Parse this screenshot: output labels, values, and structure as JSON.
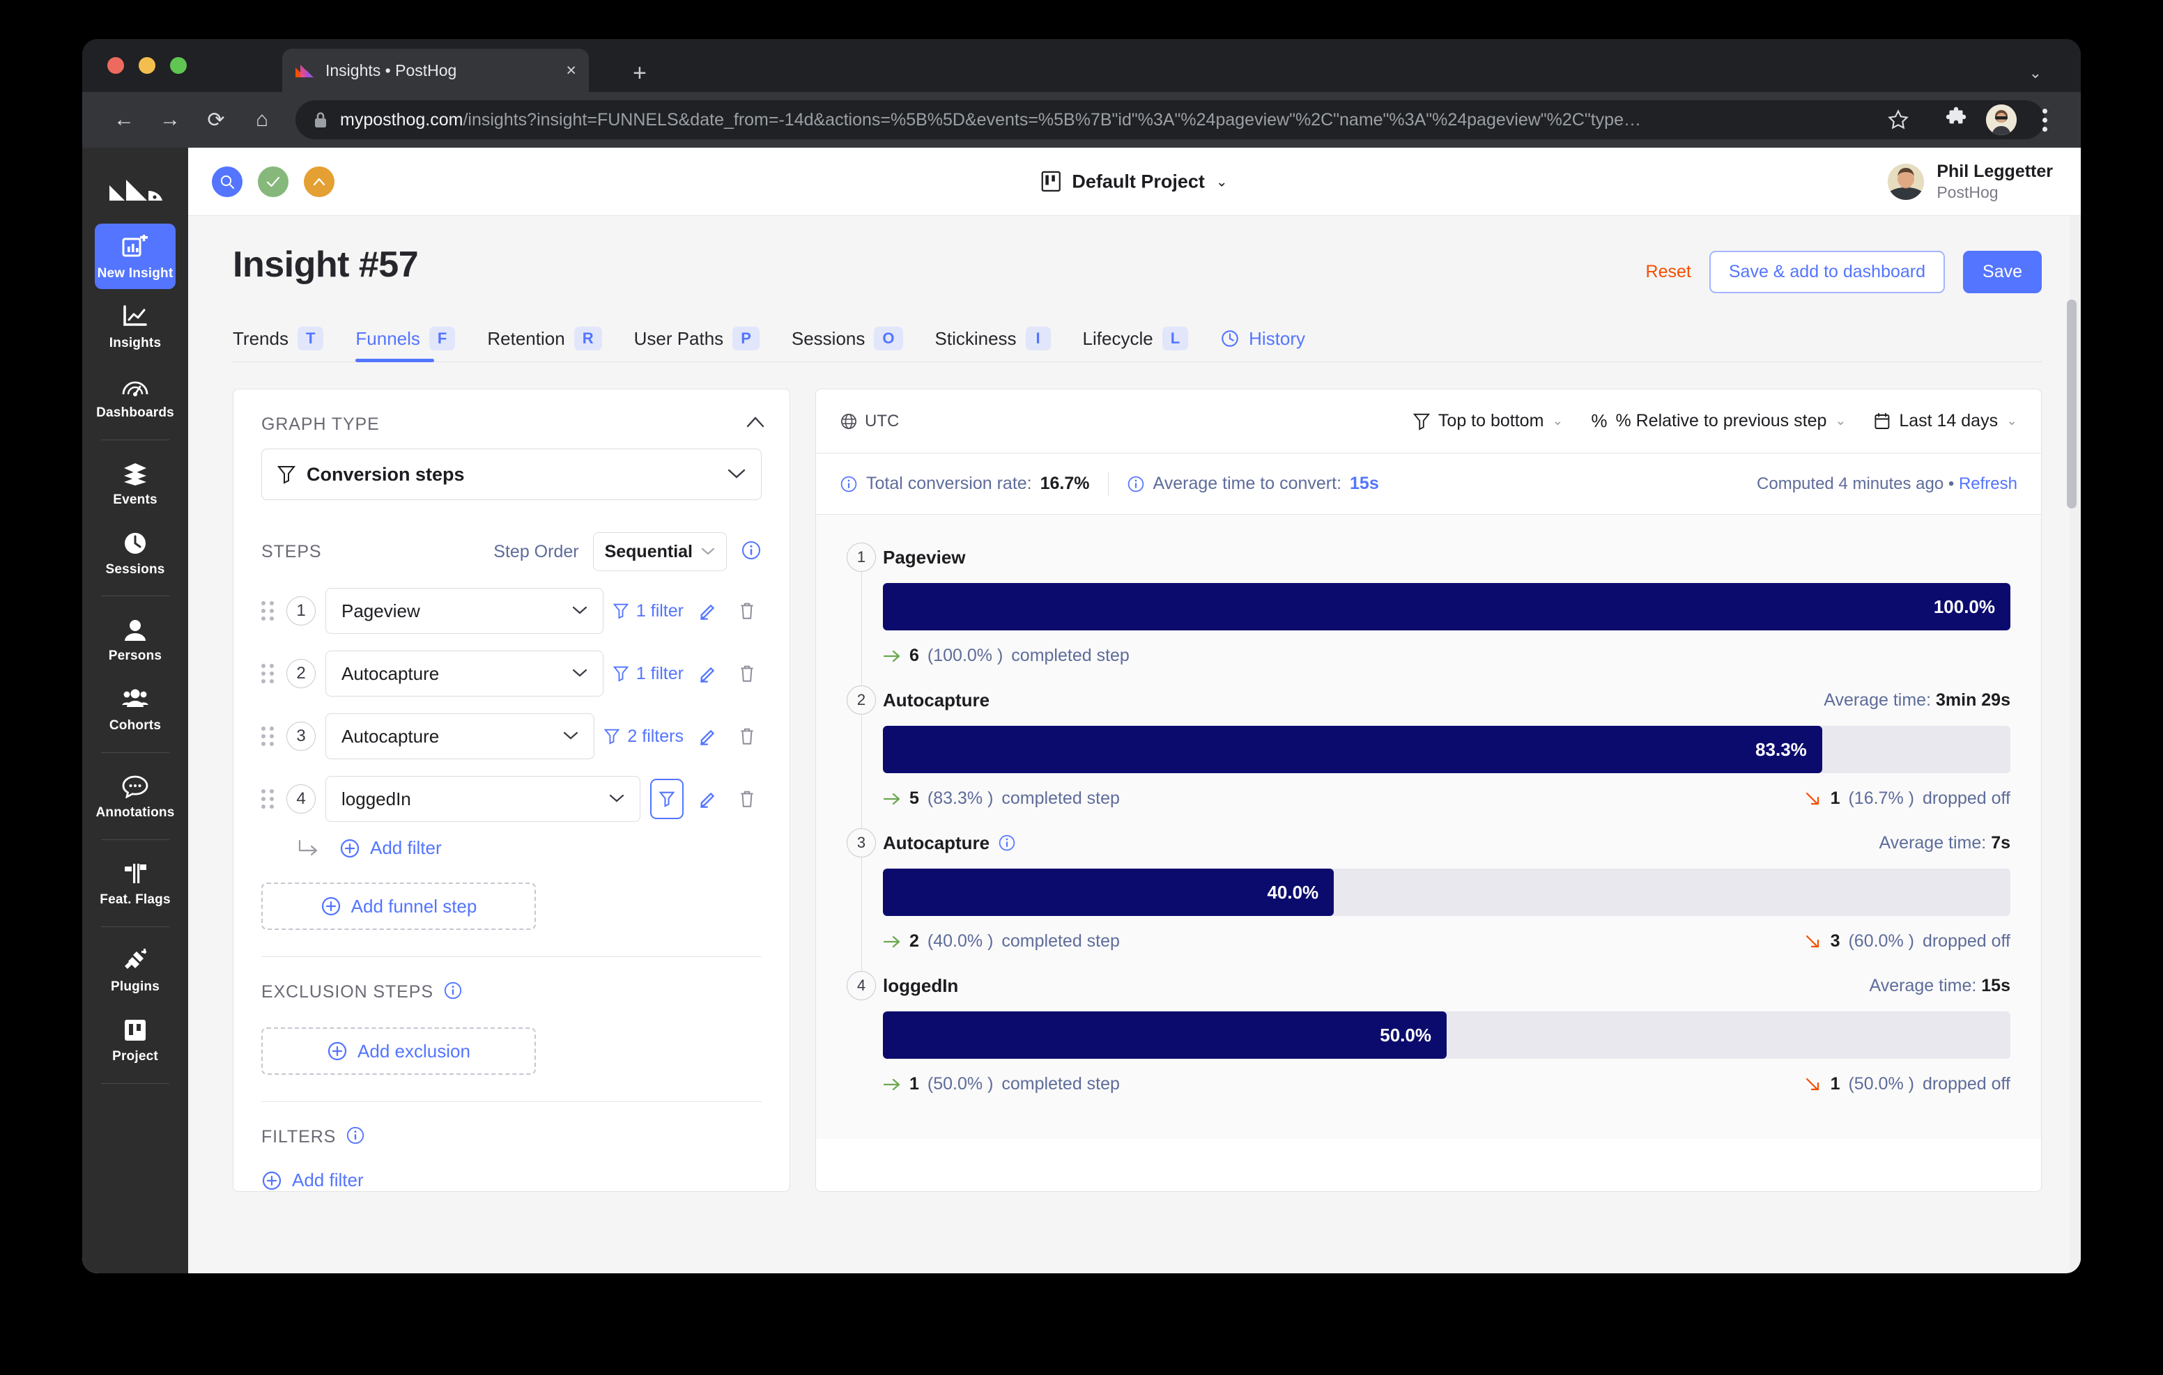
{
  "browser": {
    "tab": {
      "title": "Insights • PostHog",
      "favicon": "posthog-logo-icon",
      "close": "×"
    },
    "new_tab": "+",
    "tabstrip_chevron": "⌄",
    "nav": {
      "back": "←",
      "forward": "→",
      "reload": "⟳",
      "home": "⌂"
    },
    "url": {
      "host": "myposthog.com",
      "path": "/insights?insight=FUNNELS&date_from=-14d&actions=%5B%5D&events=%5B%7B\"id\"%3A\"%24pageview\"%2C\"name\"%3A\"%24pageview\"%2C\"type…"
    }
  },
  "sidebar": {
    "logo": "posthog-logo",
    "items": [
      {
        "label": "New Insight",
        "icon": "new-insight-icon",
        "active": true,
        "divider_after": false
      },
      {
        "label": "Insights",
        "icon": "insights-icon",
        "active": false,
        "divider_after": false
      },
      {
        "label": "Dashboards",
        "icon": "dashboards-icon",
        "active": false,
        "divider_after": true
      },
      {
        "label": "Events",
        "icon": "events-icon",
        "active": false,
        "divider_after": false
      },
      {
        "label": "Sessions",
        "icon": "sessions-icon",
        "active": false,
        "divider_after": true
      },
      {
        "label": "Persons",
        "icon": "persons-icon",
        "active": false,
        "divider_after": false
      },
      {
        "label": "Cohorts",
        "icon": "cohorts-icon",
        "active": false,
        "divider_after": true
      },
      {
        "label": "Annotations",
        "icon": "annotations-icon",
        "active": false,
        "divider_after": true
      },
      {
        "label": "Feat. Flags",
        "icon": "feature-flags-icon",
        "active": false,
        "divider_after": true
      },
      {
        "label": "Plugins",
        "icon": "plugins-icon",
        "active": false,
        "divider_after": false
      },
      {
        "label": "Project",
        "icon": "project-icon",
        "active": false,
        "divider_after": true
      }
    ]
  },
  "appbar": {
    "search_icon": "search-icon",
    "check_icon": "check-icon",
    "caret_up_icon": "caret-up-icon",
    "project_icon": "project-board-icon",
    "project_name": "Default Project",
    "project_caret": "⌄",
    "user_name": "Phil Leggetter",
    "user_org": "PostHog"
  },
  "page": {
    "title": "Insight #57",
    "reset_label": "Reset",
    "save_dashboard_label": "Save & add to dashboard",
    "save_label": "Save"
  },
  "insight_tabs": [
    {
      "label": "Trends",
      "key": "T",
      "active": false
    },
    {
      "label": "Funnels",
      "key": "F",
      "active": true
    },
    {
      "label": "Retention",
      "key": "R",
      "active": false
    },
    {
      "label": "User Paths",
      "key": "P",
      "active": false
    },
    {
      "label": "Sessions",
      "key": "O",
      "active": false
    },
    {
      "label": "Stickiness",
      "key": "I",
      "active": false
    },
    {
      "label": "Lifecycle",
      "key": "L",
      "active": false
    }
  ],
  "history_tab": {
    "label": "History",
    "icon": "clock-icon"
  },
  "left_panel": {
    "graph_type_label": "GRAPH TYPE",
    "graph_type_value": "Conversion steps",
    "graph_type_icon": "funnel-icon",
    "collapse_icon": "chevron-up-icon",
    "steps_label": "STEPS",
    "step_order_label": "Step Order",
    "step_order_value": "Sequential",
    "step_order_info_icon": "info-icon",
    "steps": [
      {
        "num": "1",
        "event": "Pageview",
        "filter_label": "1 filter",
        "has_filter_text": true,
        "filter_active": false
      },
      {
        "num": "2",
        "event": "Autocapture",
        "filter_label": "1 filter",
        "has_filter_text": true,
        "filter_active": false
      },
      {
        "num": "3",
        "event": "Autocapture",
        "filter_label": "2 filters",
        "has_filter_text": true,
        "filter_active": false
      },
      {
        "num": "4",
        "event": "loggedIn",
        "filter_label": "",
        "has_filter_text": false,
        "filter_active": true
      }
    ],
    "add_filter_label": "Add filter",
    "add_funnel_step_label": "Add funnel step",
    "exclusion_steps_label": "EXCLUSION STEPS",
    "add_exclusion_label": "Add exclusion",
    "filters_label": "FILTERS",
    "filters_add_label": "Add filter"
  },
  "right_panel": {
    "timezone": "UTC",
    "timezone_icon": "globe-icon",
    "controls": [
      {
        "label": "Top to bottom",
        "icon": "funnel-icon",
        "caret": "⌄"
      },
      {
        "label": "% Relative to previous step",
        "icon": "percent-icon",
        "caret": "⌄"
      },
      {
        "label": "Last 14 days",
        "icon": "calendar-icon",
        "caret": "⌄"
      }
    ],
    "stats": {
      "total_conversion_label": "Total conversion rate:",
      "total_conversion_value": "16.7%",
      "avg_time_label": "Average time to convert:",
      "avg_time_value": "15s",
      "computed_text": "Computed 4 minutes ago",
      "computed_sep": "•",
      "refresh_label": "Refresh",
      "info_icon": "info-icon"
    }
  },
  "chart_data": {
    "type": "bar",
    "title": "Conversion steps funnel",
    "orientation": "horizontal",
    "bar_color": "#0B0B6E",
    "track_color": "#E8E8EE",
    "categories": [
      "Pageview",
      "Autocapture",
      "Autocapture",
      "loggedIn"
    ],
    "values": [
      100.0,
      83.3,
      40.0,
      50.0
    ],
    "value_labels": [
      "100.0%",
      "83.3%",
      "40.0%",
      "50.0%"
    ],
    "ylim": [
      0,
      100
    ],
    "metric": "% Relative to previous step",
    "steps": [
      {
        "index": "1",
        "name": "Pageview",
        "percent": 100.0,
        "percent_label": "100.0%",
        "avg_time": "",
        "has_avg_time": false,
        "has_info": false,
        "completed_count": "6",
        "completed_pct": "(100.0% )",
        "completed_suffix": "completed step",
        "has_dropoff": false,
        "dropoff_count": "",
        "dropoff_pct": "",
        "dropoff_suffix": ""
      },
      {
        "index": "2",
        "name": "Autocapture",
        "percent": 83.3,
        "percent_label": "83.3%",
        "avg_time": "3min 29s",
        "has_avg_time": true,
        "has_info": false,
        "completed_count": "5",
        "completed_pct": "(83.3% )",
        "completed_suffix": "completed step",
        "has_dropoff": true,
        "dropoff_count": "1",
        "dropoff_pct": "(16.7% )",
        "dropoff_suffix": "dropped off"
      },
      {
        "index": "3",
        "name": "Autocapture",
        "percent": 40.0,
        "percent_label": "40.0%",
        "avg_time": "7s",
        "has_avg_time": true,
        "has_info": true,
        "completed_count": "2",
        "completed_pct": "(40.0% )",
        "completed_suffix": "completed step",
        "has_dropoff": true,
        "dropoff_count": "3",
        "dropoff_pct": "(60.0% )",
        "dropoff_suffix": "dropped off"
      },
      {
        "index": "4",
        "name": "loggedIn",
        "percent": 50.0,
        "percent_label": "50.0%",
        "avg_time": "15s",
        "has_avg_time": true,
        "has_info": false,
        "completed_count": "1",
        "completed_pct": "(50.0% )",
        "completed_suffix": "completed step",
        "has_dropoff": true,
        "dropoff_count": "1",
        "dropoff_pct": "(50.0% )",
        "dropoff_suffix": "dropped off"
      }
    ],
    "avg_time_prefix": "Average time:"
  },
  "colors": {
    "accent": "#5375FF",
    "reset": "#F54E00",
    "bar": "#0B0B6E",
    "sidebar": "#2D2D2D",
    "dropoff": "#F54E00",
    "completed": "#6AA84F"
  }
}
